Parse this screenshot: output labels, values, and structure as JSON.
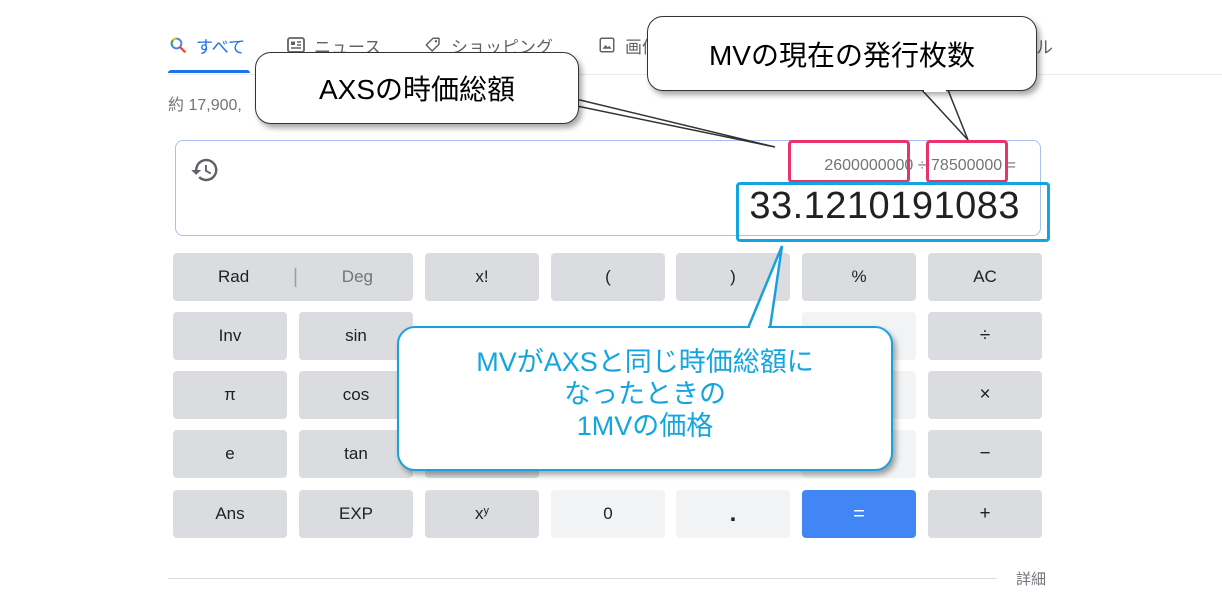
{
  "tabs": [
    {
      "label": "すべて",
      "icon": "search-icon"
    },
    {
      "label": "ニュース",
      "icon": "news-icon"
    },
    {
      "label": "ショッピング",
      "icon": "tag-icon"
    },
    {
      "label": "画像",
      "icon": "image-icon"
    },
    {
      "label": "ル",
      "icon": ""
    }
  ],
  "result_stats": "約 17,900,",
  "calculator": {
    "expression_left": "2600000000",
    "expression_op": "÷",
    "expression_right": "78500000",
    "expression_eq": "=",
    "result": "33.1210191083",
    "keys": {
      "rad": "Rad",
      "sep": "|",
      "deg": "Deg",
      "fact": "x!",
      "lparen": "(",
      "rparen": ")",
      "percent": "%",
      "ac": "AC",
      "inv": "Inv",
      "sin": "sin",
      "divide": "÷",
      "pi": "π",
      "cos": "cos",
      "multiply": "×",
      "e": "e",
      "tan": "tan",
      "minus": "−",
      "ans": "Ans",
      "exp": "EXP",
      "pow_base": "x",
      "pow_exp": "y",
      "zero": "0",
      "dot": ".",
      "equals": "=",
      "plus": "+"
    }
  },
  "details": "詳細",
  "annotations": {
    "market_cap_axs": "AXSの時価総額",
    "mv_supply": "MVの現在の発行枚数",
    "mv_price_lines": [
      "MVがAXSと同じ時価総額に",
      "なったときの",
      "1MVの価格"
    ]
  },
  "colors": {
    "accent": "#1a73e8",
    "equals_key": "#4285f4",
    "highlight_red": "#e8336b",
    "highlight_blue": "#12a5e0"
  }
}
